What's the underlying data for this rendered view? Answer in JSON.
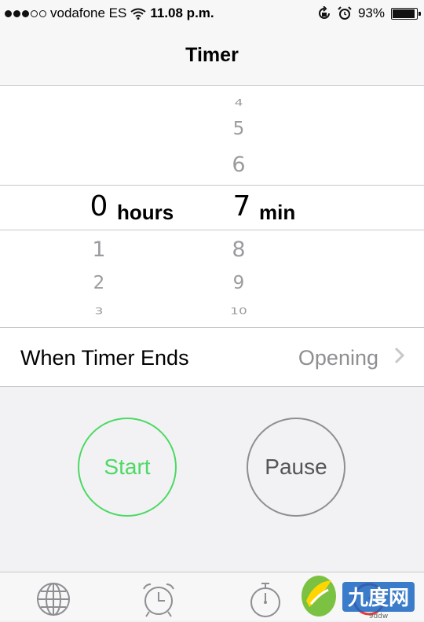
{
  "status_bar": {
    "carrier": "vodafone ES",
    "time": "11.08 p.m.",
    "battery": "93%",
    "battery_level": 0.93,
    "signal_bars": 3,
    "signal_total": 5
  },
  "nav": {
    "title": "Timer"
  },
  "picker": {
    "hours": {
      "above": [
        "",
        ""
      ],
      "selected": "0",
      "below": [
        "1",
        "2",
        "3"
      ],
      "unit": "hours"
    },
    "minutes": {
      "above": [
        "4",
        "5",
        "6"
      ],
      "selected": "7",
      "below": [
        "8",
        "9",
        "10"
      ],
      "unit": "min"
    }
  },
  "timer_ends": {
    "label": "When Timer Ends",
    "value": "Opening"
  },
  "buttons": {
    "start": {
      "label": "Start",
      "color": "#4cd964"
    },
    "pause": {
      "label": "Pause",
      "color": "#8e8e93"
    }
  },
  "tabs": [
    {
      "icon": "globe-icon"
    },
    {
      "icon": "alarm-clock-icon"
    },
    {
      "icon": "stopwatch-icon"
    },
    {
      "icon": "timer-icon"
    }
  ],
  "watermark": {
    "text": "9ddw"
  }
}
